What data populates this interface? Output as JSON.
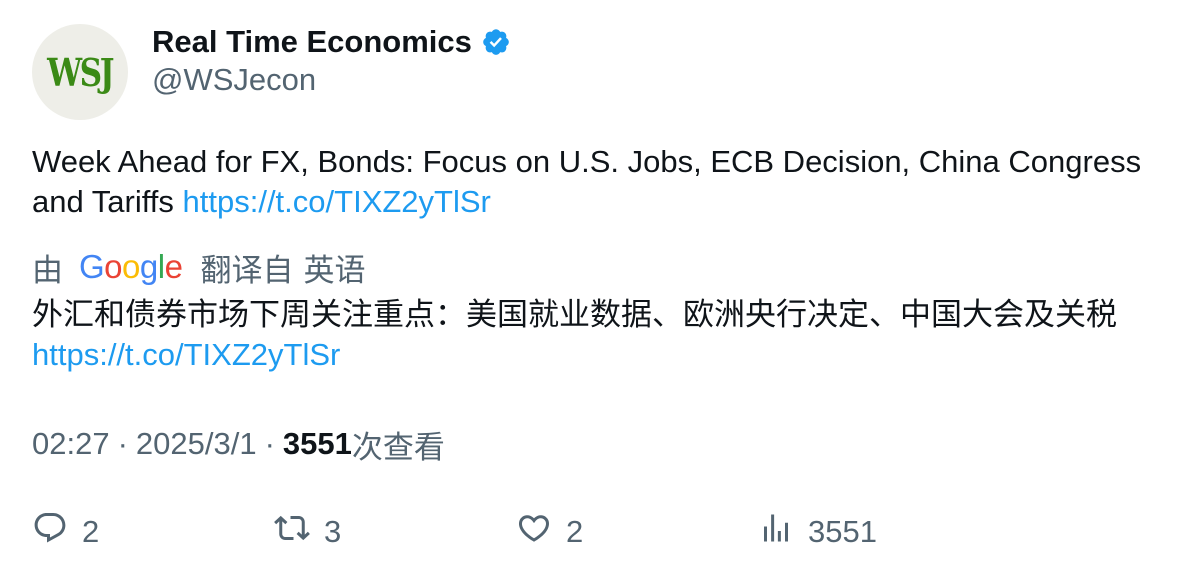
{
  "author": {
    "display_name": "Real Time Economics",
    "handle": "@WSJecon",
    "avatar_text": "WSJ",
    "verified_icon": "verified-badge-icon"
  },
  "tweet": {
    "text": "Week Ahead for FX, Bonds: Focus on U.S. Jobs, ECB Decision, China Congress and Tariffs ",
    "link": "https://t.co/TIXZ2yTlSr"
  },
  "translation": {
    "by": "由",
    "provider_letters": [
      "G",
      "o",
      "o",
      "g",
      "l",
      "e"
    ],
    "from": "翻译自",
    "language": "英语",
    "text": "外汇和债券市场下周关注重点：美国就业数据、欧洲央行决定、中国大会及关税",
    "link": "https://t.co/TIXZ2yTlSr"
  },
  "meta": {
    "time": "02:27",
    "separator": "·",
    "date": "2025/3/1",
    "views_count": "3551",
    "views_label": "次查看"
  },
  "actions": {
    "reply_count": "2",
    "retweet_count": "3",
    "like_count": "2",
    "views_count": "3551"
  },
  "colors": {
    "link": "#1d9bf0",
    "verified": "#1d9bf0",
    "secondary_text": "#536471",
    "primary_text": "#0f1419",
    "wsj_green": "#3b8a16"
  }
}
